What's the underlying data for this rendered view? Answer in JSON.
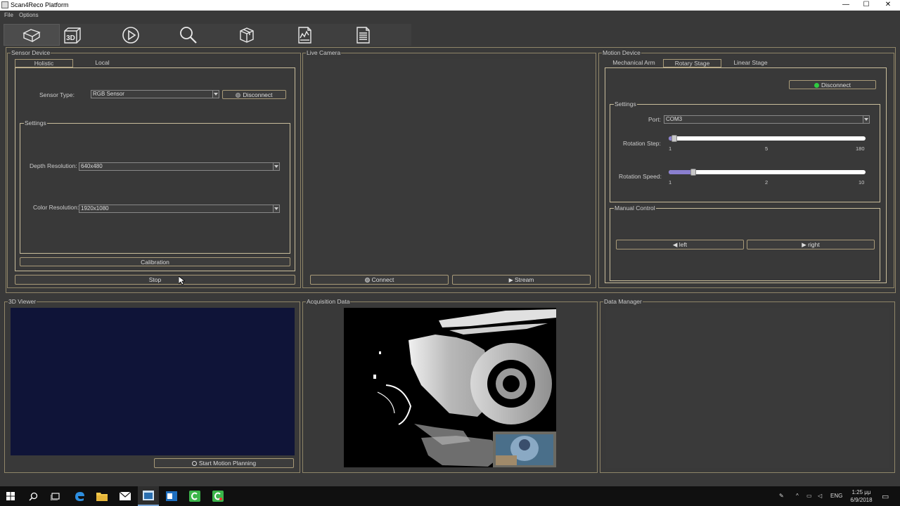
{
  "window": {
    "title": "Scan4Reco Platform",
    "controls": [
      "—",
      "☐",
      "✕"
    ]
  },
  "menu": {
    "items": [
      "File",
      "Options"
    ]
  },
  "toolbar": {
    "buttons": [
      {
        "icon": "cube-icon",
        "active": true
      },
      {
        "icon": "3d-icon",
        "label": "3D"
      },
      {
        "icon": "play-icon"
      },
      {
        "icon": "search-icon"
      },
      {
        "icon": "package-icon"
      },
      {
        "icon": "chart-document-icon"
      },
      {
        "icon": "report-document-icon"
      }
    ]
  },
  "sensor_device": {
    "title": "Sensor Device",
    "tabs": [
      "Holistic",
      "Local"
    ],
    "sensor_type_label": "Sensor Type:",
    "sensor_type_value": "RGB Sensor",
    "disconnect_label": "Disconnect",
    "settings_title": "Settings",
    "depth_resolution_label": "Depth Resolution:",
    "depth_resolution_value": "640x480",
    "color_resolution_label": "Color Resolution:",
    "color_resolution_value": "1920x1080",
    "calibration_label": "Calibration",
    "stop_label": "Stop"
  },
  "live_camera": {
    "title": "Live Camera",
    "connect_label": "Connect",
    "stream_label": "Stream"
  },
  "motion_device": {
    "title": "Motion Device",
    "tabs": [
      "Mechanical Arm",
      "Rotary Stage",
      "Linear Stage"
    ],
    "active_tab": 1,
    "disconnect_label": "Disconnect",
    "status_color": "#2ecc40",
    "settings_title": "Settings",
    "port_label": "Port:",
    "port_value": "COM3",
    "rotation_step_label": "Rotation Step:",
    "rotation_step": {
      "min": "1",
      "mid": "5",
      "max": "180",
      "value": 1
    },
    "rotation_speed_label": "Rotation Speed:",
    "rotation_speed": {
      "min": "1",
      "mid": "2",
      "max": "10",
      "value": 2
    },
    "manual_control_title": "Manual Control",
    "left_label": "left",
    "right_label": "right"
  },
  "viewer_3d": {
    "title": "3D Viewer",
    "start_motion_label": "Start Motion Planning",
    "background": "#0f1438"
  },
  "acquisition_data": {
    "title": "Acquisition Data"
  },
  "data_manager": {
    "title": "Data Manager"
  },
  "taskbar": {
    "apps": [
      "start-icon",
      "search-icon",
      "task-view-icon",
      "edge-icon",
      "file-explorer-icon",
      "mail-icon",
      "scan4reco-app-icon",
      "outlook-icon",
      "camtasia-icon",
      "camtasia-recorder-icon"
    ],
    "language": "ENG",
    "time": "1:25 μμ",
    "date": "6/9/2018"
  }
}
